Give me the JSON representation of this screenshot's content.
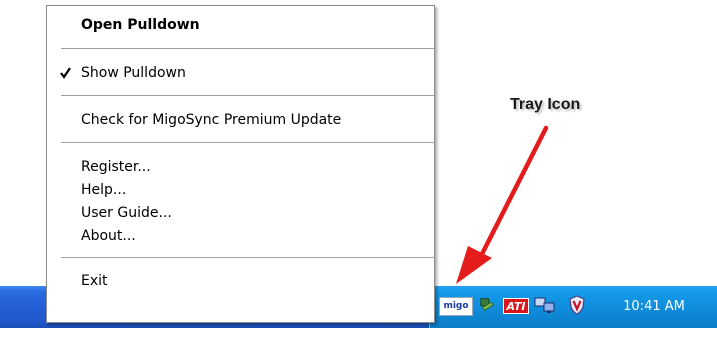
{
  "menu": {
    "items": [
      {
        "label": "Open Pulldown",
        "bold": true
      },
      {
        "label": "Show Pulldown",
        "checked": true
      },
      {
        "label": "Check for MigoSync Premium Update"
      },
      {
        "label": "Register..."
      },
      {
        "label": "Help..."
      },
      {
        "label": "User Guide..."
      },
      {
        "label": "About..."
      },
      {
        "label": "Exit"
      }
    ]
  },
  "annotation": {
    "label": "Tray Icon",
    "arrow_color": "#e41c1c"
  },
  "taskbar": {
    "clock": "10:41 AM",
    "tray_icons": [
      "migo-icon",
      "network-icon",
      "ati-icon",
      "display-icon",
      "security-shield-icon"
    ],
    "migo_icon_text": "migo",
    "ati_icon_text": "ATI"
  },
  "colors": {
    "taskbar": "#235ed6",
    "tray": "#0f8ad8",
    "arrow": "#e41c1c"
  }
}
